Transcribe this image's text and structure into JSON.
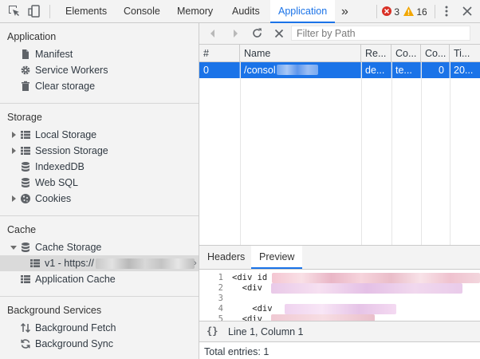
{
  "toolbar": {
    "tabs": [
      "Elements",
      "Console",
      "Memory",
      "Audits",
      "Application"
    ],
    "active_tab": "Application",
    "more_symbol": "»",
    "error_count": "3",
    "warning_count": "16",
    "accent_color": "#1a73e8"
  },
  "sidebar": {
    "application": {
      "header": "Application",
      "items": [
        {
          "label": "Manifest",
          "icon": "document-icon"
        },
        {
          "label": "Service Workers",
          "icon": "gear-icon"
        },
        {
          "label": "Clear storage",
          "icon": "trash-icon"
        }
      ]
    },
    "storage": {
      "header": "Storage",
      "items": [
        {
          "label": "Local Storage",
          "icon": "grid-icon",
          "expandable": true
        },
        {
          "label": "Session Storage",
          "icon": "grid-icon",
          "expandable": true
        },
        {
          "label": "IndexedDB",
          "icon": "database-icon"
        },
        {
          "label": "Web SQL",
          "icon": "database-icon"
        },
        {
          "label": "Cookies",
          "icon": "cookie-icon",
          "expandable": true
        }
      ]
    },
    "cache": {
      "header": "Cache",
      "items": [
        {
          "label": "Cache Storage",
          "icon": "database-icon",
          "expanded": true
        },
        {
          "label": "v1 - https://",
          "icon": "grid-icon",
          "selected": true
        },
        {
          "label": "Application Cache",
          "icon": "grid-icon"
        }
      ]
    },
    "background_services": {
      "header": "Background Services",
      "items": [
        {
          "label": "Background Fetch",
          "icon": "fetch-arrows-icon"
        },
        {
          "label": "Background Sync",
          "icon": "sync-icon"
        }
      ]
    }
  },
  "main": {
    "filter_placeholder": "Filter by Path",
    "table": {
      "headers": [
        "#",
        "Name",
        "Re...",
        "Co...",
        "Co...",
        "Ti..."
      ],
      "rows": [
        {
          "index": "0",
          "name": "/consol",
          "response_type": "de...",
          "content_type": "te...",
          "content_length": "0",
          "time": "20..."
        }
      ]
    },
    "detail_tabs": [
      "Headers",
      "Preview"
    ],
    "active_detail_tab": "Preview",
    "code_lines": [
      {
        "num": "1",
        "text": "<div id"
      },
      {
        "num": "2",
        "text": "  <div"
      },
      {
        "num": "3",
        "text": ""
      },
      {
        "num": "4",
        "text": "    <div"
      },
      {
        "num": "5",
        "text": "  <div"
      }
    ],
    "format_symbol": "{}",
    "cursor_position": "Line 1, Column 1",
    "total_entries": "Total entries: 1"
  }
}
